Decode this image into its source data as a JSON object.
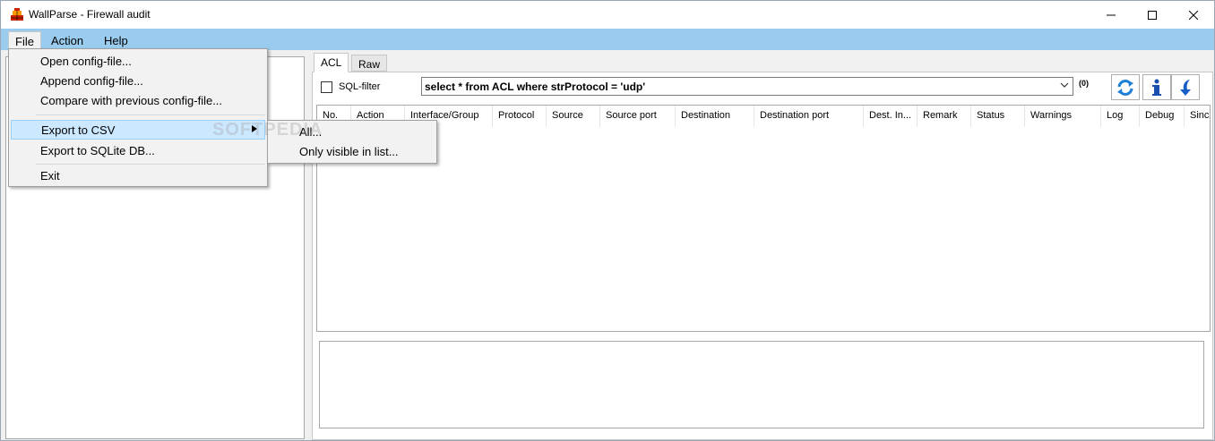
{
  "window": {
    "title": "WallParse - Firewall audit"
  },
  "menubar": {
    "file": "File",
    "action": "Action",
    "help": "Help"
  },
  "file_menu": {
    "items": [
      "Open config-file...",
      "Append config-file...",
      "Compare with previous config-file...",
      "Export to CSV",
      "Export to SQLite DB...",
      "Exit"
    ]
  },
  "csv_submenu": {
    "items": [
      "All...",
      "Only visible in list..."
    ]
  },
  "tabs": {
    "acl": "ACL",
    "raw": "Raw"
  },
  "filter": {
    "label": "SQL-filter",
    "query": "select * from ACL where strProtocol = 'udp'",
    "count": "(0)"
  },
  "table": {
    "columns": [
      "No.",
      "Action",
      "Interface/Group",
      "Protocol",
      "Source",
      "Source port",
      "Destination",
      "Destination port",
      "Dest. In...",
      "Remark",
      "Status",
      "Warnings",
      "Log",
      "Debug",
      "Sinc"
    ]
  },
  "watermark": "SOFTPEDIA",
  "colors": {
    "menubar": "#99ccee",
    "highlight": "#cce8ff"
  }
}
